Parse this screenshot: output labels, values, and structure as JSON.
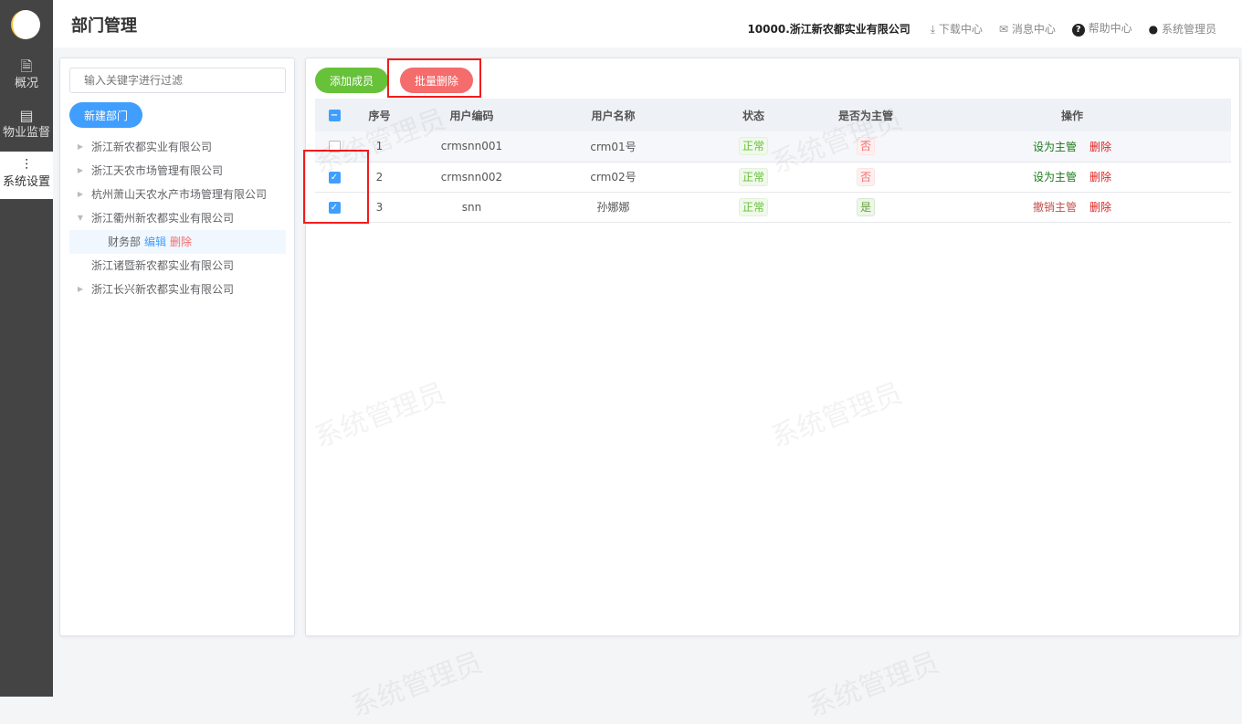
{
  "sidebar": {
    "items": [
      {
        "label": "概况",
        "icon": "document-icon"
      },
      {
        "label": "物业监督",
        "icon": "list-icon"
      },
      {
        "label": "系统设置",
        "icon": "sliders-icon"
      }
    ]
  },
  "header": {
    "title": "部门管理",
    "org": "10000.浙江新农都实业有限公司",
    "download": "下载中心",
    "messages": "消息中心",
    "help": "帮助中心",
    "user": "系统管理员"
  },
  "left": {
    "filter_placeholder": "输入关键字进行过滤",
    "new_dept": "新建部门",
    "tree": [
      {
        "label": "浙江新农都实业有限公司"
      },
      {
        "label": "浙江天农市场管理有限公司"
      },
      {
        "label": "杭州萧山天农水产市场管理有限公司"
      },
      {
        "label": "浙江衢州新农都实业有限公司"
      },
      {
        "label": "浙江诸暨新农都实业有限公司"
      },
      {
        "label": "浙江长兴新农都实业有限公司"
      }
    ],
    "child": {
      "label": "财务部",
      "edit": "编辑",
      "delete": "删除"
    }
  },
  "toolbar": {
    "add": "添加成员",
    "batch_delete": "批量删除"
  },
  "table": {
    "headers": [
      "序号",
      "用户编码",
      "用户名称",
      "状态",
      "是否为主管",
      "操作"
    ],
    "rows": [
      {
        "no": "1",
        "code": "crmsnn001",
        "name": "crm01号",
        "status": "正常",
        "manager": "否",
        "action": "设为主管",
        "delete": "删除",
        "checked": false
      },
      {
        "no": "2",
        "code": "crmsnn002",
        "name": "crm02号",
        "status": "正常",
        "manager": "否",
        "action": "设为主管",
        "delete": "删除",
        "checked": true
      },
      {
        "no": "3",
        "code": "snn",
        "name": "孙娜娜",
        "status": "正常",
        "manager": "是",
        "action": "撤销主管",
        "delete": "删除",
        "checked": true
      }
    ]
  },
  "watermark": "系统管理员"
}
